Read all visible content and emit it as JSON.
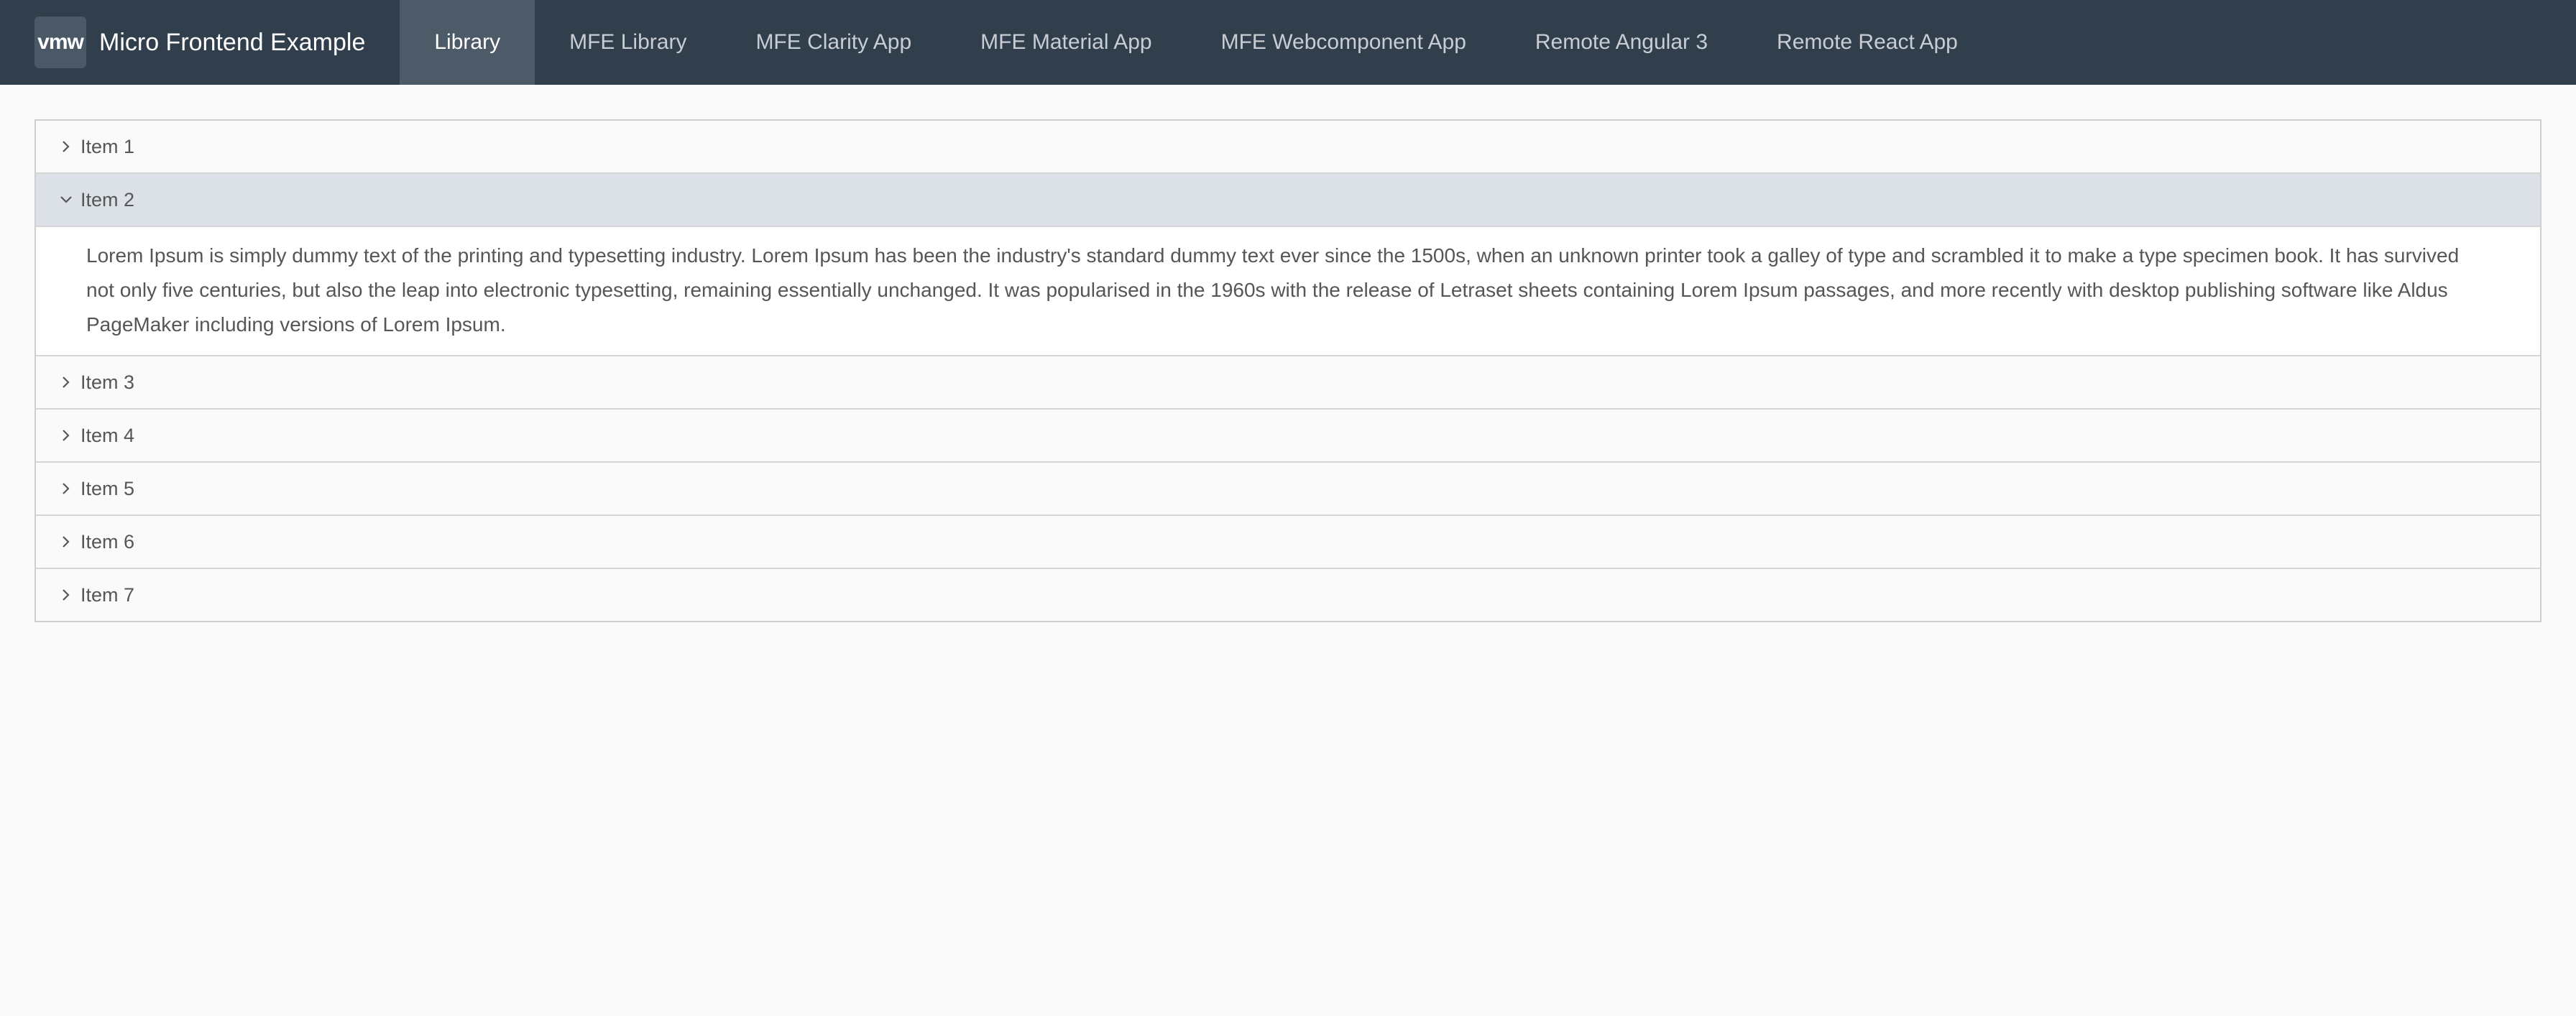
{
  "header": {
    "logo_text": "vmw",
    "title": "Micro Frontend Example",
    "nav": [
      {
        "label": "Library",
        "active": true
      },
      {
        "label": "MFE Library"
      },
      {
        "label": "MFE Clarity App"
      },
      {
        "label": "MFE Material App"
      },
      {
        "label": "MFE Webcomponent App"
      },
      {
        "label": "Remote Angular 3"
      },
      {
        "label": "Remote React App"
      }
    ]
  },
  "accordion": {
    "items": [
      {
        "label": "Item 1"
      },
      {
        "label": "Item 2",
        "content": "Lorem Ipsum is simply dummy text of the printing and typesetting industry. Lorem Ipsum has been the industry's standard dummy text ever since the 1500s, when an unknown printer took a galley of type and scrambled it to make a type specimen book. It has survived not only five centuries, but also the leap into electronic typesetting, remaining essentially unchanged. It was popularised in the 1960s with the release of Letraset sheets containing Lorem Ipsum passages, and more recently with desktop publishing software like Aldus PageMaker including versions of Lorem Ipsum."
      },
      {
        "label": "Item 3"
      },
      {
        "label": "Item 4"
      },
      {
        "label": "Item 5"
      },
      {
        "label": "Item 6"
      },
      {
        "label": "Item 7"
      }
    ]
  },
  "icons": {
    "collapsed": "chevron-right-icon",
    "expanded": "chevron-down-icon"
  },
  "colors": {
    "header_bg": "#313f4c",
    "active_tab_bg": "#4d5a67",
    "open_panel_bg": "#dbe1e6"
  }
}
